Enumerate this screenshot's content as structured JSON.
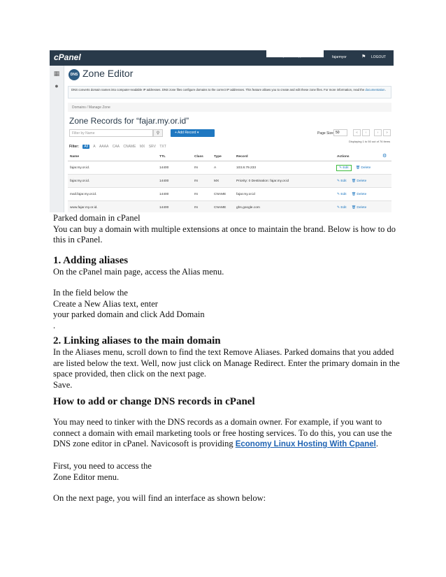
{
  "screenshot": {
    "topbar": {
      "logo": "cPanel",
      "search_placeholder": "Search (/)",
      "user": "fajarmyor",
      "logout": "LOGOUT"
    },
    "title": "Zone Editor",
    "title_icon": "DNS",
    "info_text": "DNS converts domain names into computer-readable IP addresses. DNS zone files configure domains to the correct IP addresses. This feature allows you to create and edit these zone files. For more information, read the",
    "info_link": "documentation",
    "breadcrumb": [
      "Domains",
      "Manage Zone"
    ],
    "zone_title": "Zone Records for “fajar.my.or.id”",
    "filter_placeholder": "Filter by Name",
    "add_record_label": "+ Add Record  ▾",
    "page_size_label": "Page Size",
    "page_size_value": "50",
    "displaying": "Displaying 1 to 50 out of 76 items",
    "filter_label": "Filter:",
    "filter_chips": [
      "All",
      "A",
      "AAAA",
      "CAA",
      "CNAME",
      "MX",
      "SRV",
      "TXT"
    ],
    "columns": [
      "Name",
      "TTL",
      "Class",
      "Type",
      "Record",
      "Actions"
    ],
    "rows": [
      {
        "name": "fajar.my.or.id.",
        "ttl": "14400",
        "class": "IN",
        "type": "A",
        "record": "103.8.79.233",
        "edit": "Edit",
        "delete": "Delete"
      },
      {
        "name": "fajar.my.or.id.",
        "ttl": "14400",
        "class": "IN",
        "type": "MX",
        "record": "Priority: 0 Destination: fajar.my.or.id",
        "edit": "Edit",
        "delete": "Delete"
      },
      {
        "name": "mail.fajar.my.or.id.",
        "ttl": "14400",
        "class": "IN",
        "type": "CNAME",
        "record": "fajar.my.or.id",
        "edit": "Edit",
        "delete": "Delete"
      },
      {
        "name": "www.fajar.my.or.id.",
        "ttl": "14400",
        "class": "IN",
        "type": "CNAME",
        "record": "ghs.google.com",
        "edit": "Edit",
        "delete": "Delete"
      }
    ]
  },
  "doc": {
    "caption": "Parked domain in cPanel",
    "intro": "You can buy a domain with multiple extensions at once to maintain the brand. Below is how to do this in cPanel.",
    "h1": "1. Adding aliases",
    "p1": " On the cPanel main page, access the Alias menu.",
    "p2_line1": "In the field below the",
    "p2_line2": "Create a New Alias text, enter",
    "p2_line3": "your parked domain and click Add Domain",
    "p2_line4": ".",
    "h2": "2. Linking aliases to the main domain",
    "p3": "In the Aliases menu, scroll down to find the text Remove Aliases. Parked domains that you added are listed below the text. Well, now just click on Manage Redirect. Enter the primary domain in the space provided, then click on the next page.",
    "p3_save": "Save.",
    "h3": "How to add or change DNS records in cPanel",
    "p4": "You may need to tinker with the DNS records as a domain owner. For example, if you want to connect a domain with email marketing tools or free hosting services. To do this, you can use the DNS zone editor in cPanel. Navicosoft is providing ",
    "p4_link": "Economy Linux Hosting With Cpanel",
    "p4_end": ".",
    "p5_line1": "First, you need to access the",
    "p5_line2": "Zone Editor menu.",
    "p6": "On the next page, you will find an interface as shown below:"
  }
}
